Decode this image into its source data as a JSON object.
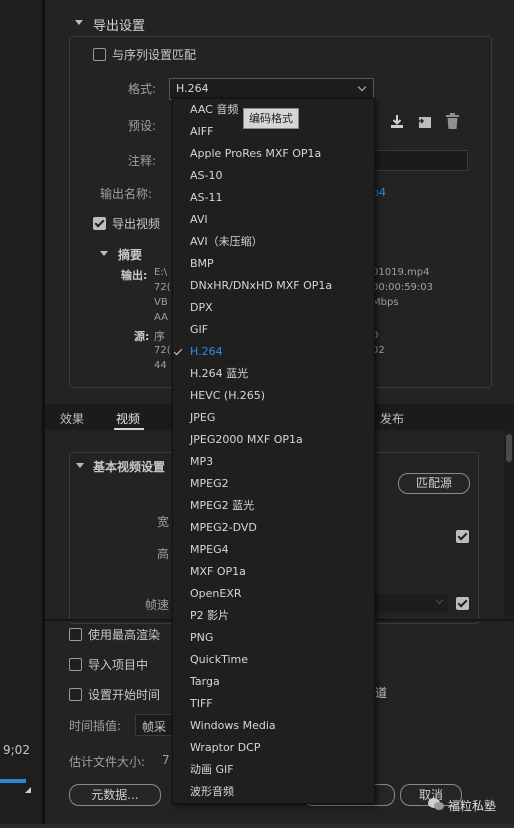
{
  "panel": {
    "export_settings_title": "导出设置",
    "match_sequence_label": "与序列设置匹配",
    "format_label": "格式:",
    "format_value": "H.264",
    "preset_label": "预设:",
    "comment_label": "注释:",
    "output_name_label": "输出名称:",
    "output_name_value": "p4",
    "export_video_label": "导出视频",
    "summary_label": "摘要",
    "output_label": "输出:",
    "output_lines": [
      "E:\\",
      "72(",
      "VB",
      "AA"
    ],
    "output_right_lines": [
      "01019.mp4",
      "00:00:59:03",
      "Mbps"
    ],
    "source_label": "源:",
    "source_lines": [
      "序",
      "72(",
      "44"
    ],
    "source_right_lines": [
      "0",
      "02"
    ]
  },
  "tooltip": "编码格式",
  "tabs": [
    "效果",
    "视频",
    "发布"
  ],
  "video_section": {
    "title": "基本视频设置",
    "match_source_button": "匹配源",
    "width_label": "宽",
    "height_label": "高",
    "fps_label": "帧速"
  },
  "bottom": {
    "max_render_label": "使用最高渲染",
    "import_project_label": "导入项目中",
    "set_start_label": "设置开始时间",
    "interp_label": "时间插值:",
    "interp_value": "帧采",
    "est_size_label": "估计文件大小:",
    "est_size_value": "7",
    "metadata_button": "元数据...",
    "cancel_button": "取消",
    "timecode": "9;02",
    "right_fragment": "道"
  },
  "watermark": "福粒私塾",
  "dropdown": {
    "items": [
      "AAC 音频",
      "AIFF",
      "Apple ProRes MXF OP1a",
      "AS-10",
      "AS-11",
      "AVI",
      "AVI（未压缩）",
      "BMP",
      "DNxHR/DNxHD MXF OP1a",
      "DPX",
      "GIF",
      "H.264",
      "H.264 蓝光",
      "HEVC (H.265)",
      "JPEG",
      "JPEG2000 MXF OP1a",
      "MP3",
      "MPEG2",
      "MPEG2 蓝光",
      "MPEG2-DVD",
      "MPEG4",
      "MXF OP1a",
      "OpenEXR",
      "P2 影片",
      "PNG",
      "QuickTime",
      "Targa",
      "TIFF",
      "Windows Media",
      "Wraptor DCP",
      "动画 GIF",
      "波形音频"
    ],
    "selected": "H.264"
  },
  "colors": {
    "accent": "#2d8ceb",
    "progress": "#2a8ad6"
  }
}
